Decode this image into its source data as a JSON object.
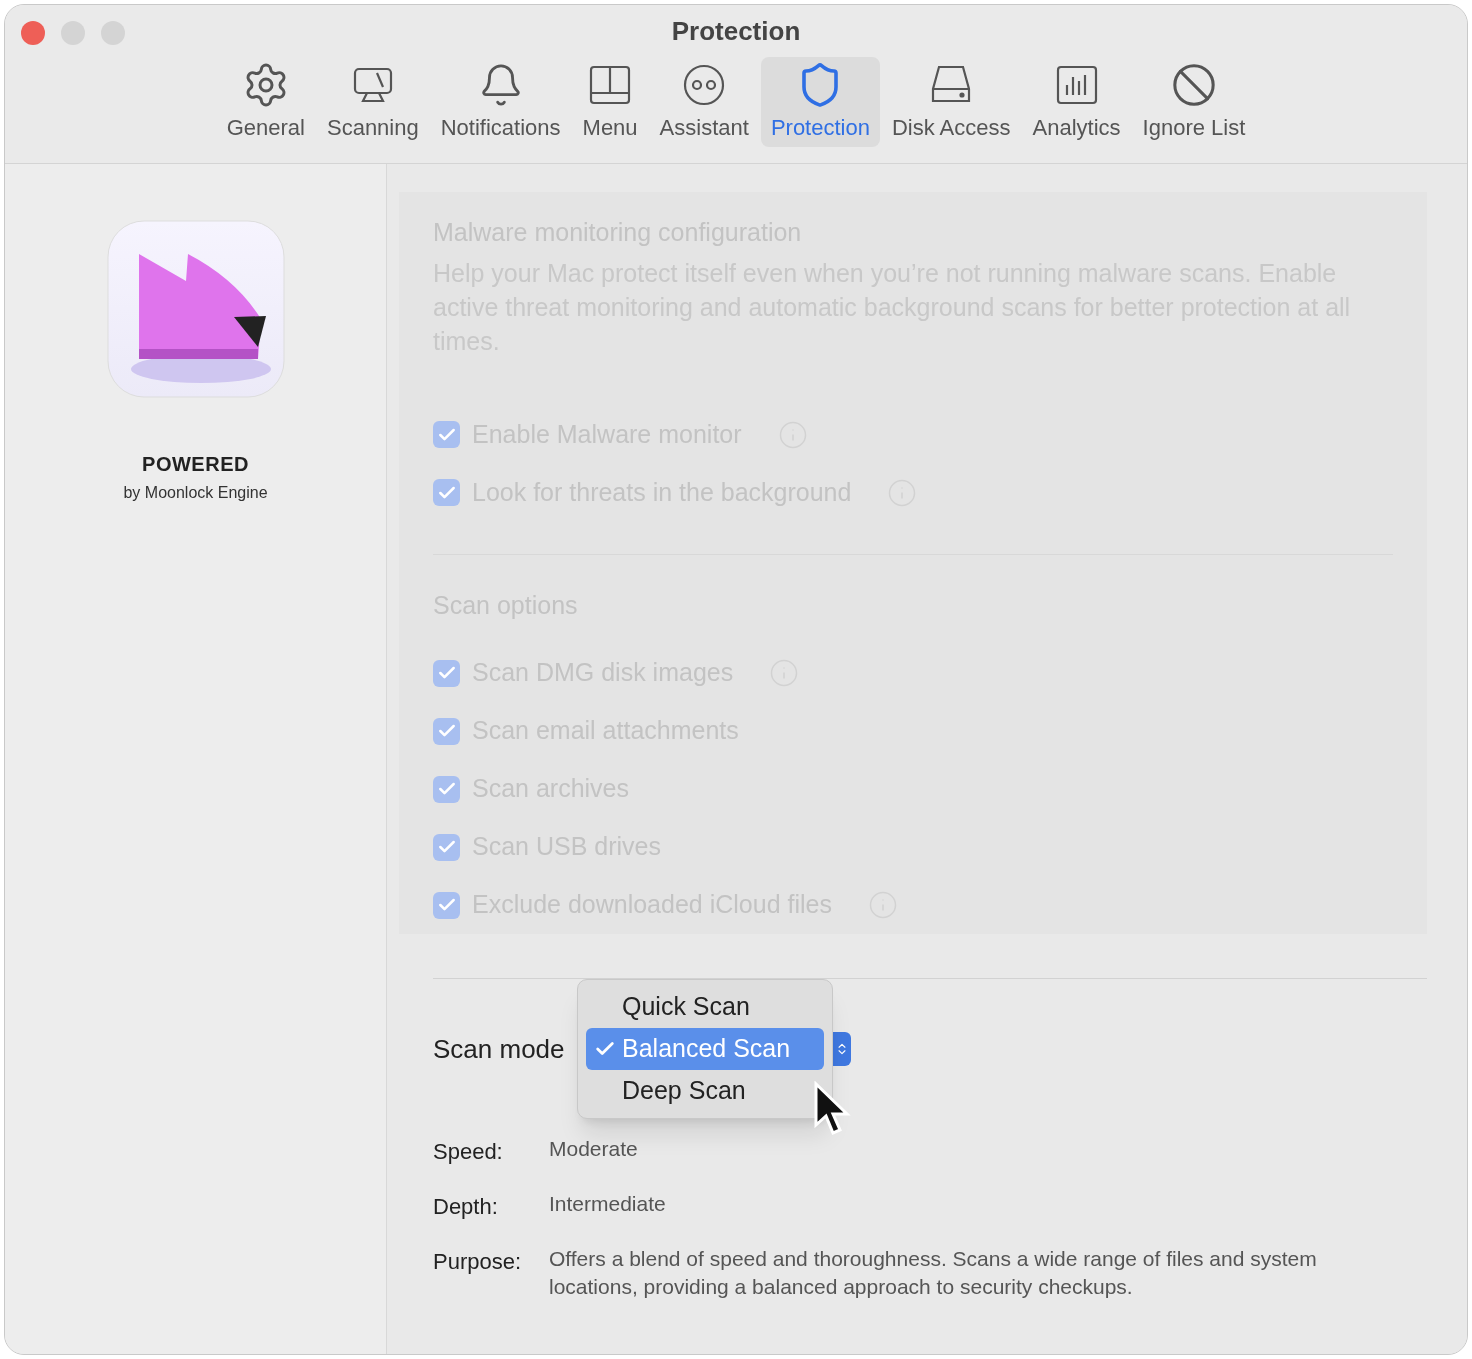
{
  "window": {
    "title": "Protection"
  },
  "tabs": [
    {
      "label": "General",
      "selected": false
    },
    {
      "label": "Scanning",
      "selected": false
    },
    {
      "label": "Notifications",
      "selected": false
    },
    {
      "label": "Menu",
      "selected": false
    },
    {
      "label": "Assistant",
      "selected": false
    },
    {
      "label": "Protection",
      "selected": true
    },
    {
      "label": "Disk Access",
      "selected": false
    },
    {
      "label": "Analytics",
      "selected": false
    },
    {
      "label": "Ignore List",
      "selected": false
    }
  ],
  "sidebar": {
    "title": "POWERED",
    "subtitle": "by Moonlock Engine"
  },
  "monitoring": {
    "disabled": true,
    "title": "Malware monitoring configuration",
    "description": "Help your Mac protect itself even when you’re not running malware scans. Enable active threat monitoring and automatic background scans for better protection at all times.",
    "options": [
      {
        "label": "Enable Malware monitor",
        "checked": true,
        "info": true
      },
      {
        "label": "Look for threats in the background",
        "checked": true,
        "info": true
      }
    ]
  },
  "scan_options": {
    "disabled": true,
    "title": "Scan options",
    "options": [
      {
        "label": "Scan DMG disk images",
        "checked": true,
        "info": true
      },
      {
        "label": "Scan email attachments",
        "checked": true,
        "info": false
      },
      {
        "label": "Scan archives",
        "checked": true,
        "info": false
      },
      {
        "label": "Scan USB drives",
        "checked": true,
        "info": false
      },
      {
        "label": "Exclude downloaded iCloud files",
        "checked": true,
        "info": true
      }
    ]
  },
  "scan_mode": {
    "label": "Scan mode",
    "menu": [
      {
        "label": "Quick Scan",
        "selected": false
      },
      {
        "label": "Balanced Scan",
        "selected": true
      },
      {
        "label": "Deep Scan",
        "selected": false
      }
    ],
    "details": [
      {
        "label": "Speed:",
        "value": "Moderate"
      },
      {
        "label": "Depth:",
        "value": "Intermediate"
      },
      {
        "label": "Purpose:",
        "value": "Offers a blend of speed and thoroughness. Scans a wide range of files and system locations, providing a balanced approach to security checkups."
      }
    ]
  }
}
